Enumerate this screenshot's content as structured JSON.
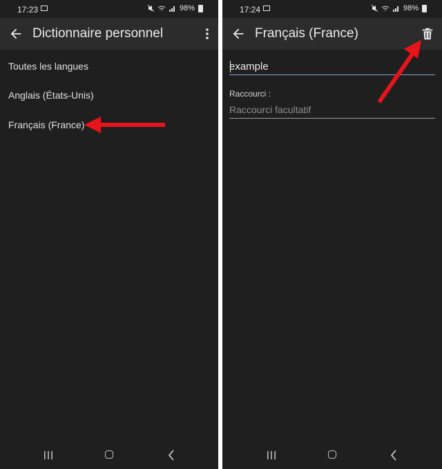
{
  "left": {
    "status": {
      "time": "17:23",
      "battery": "98%"
    },
    "header": {
      "title": "Dictionnaire personnel"
    },
    "languages": [
      {
        "label": "Toutes les langues"
      },
      {
        "label": "Anglais (États-Unis)"
      },
      {
        "label": "Français (France)"
      }
    ]
  },
  "right": {
    "status": {
      "time": "17:24",
      "battery": "98%"
    },
    "header": {
      "title": "Français (France)"
    },
    "word_field": {
      "value": "example"
    },
    "shortcut": {
      "label": "Raccourci :",
      "placeholder": "Raccourci facultatif"
    }
  },
  "icons": {
    "back": "arrow-back-icon",
    "menu": "more-vert-icon",
    "delete": "trash-icon",
    "nav_recents": "recents-icon",
    "nav_home": "home-icon",
    "nav_back": "chevron-left-icon"
  },
  "colors": {
    "background": "#1f1f1f",
    "appbar": "#2c2c2c",
    "annotation_arrow": "#e8141b"
  }
}
